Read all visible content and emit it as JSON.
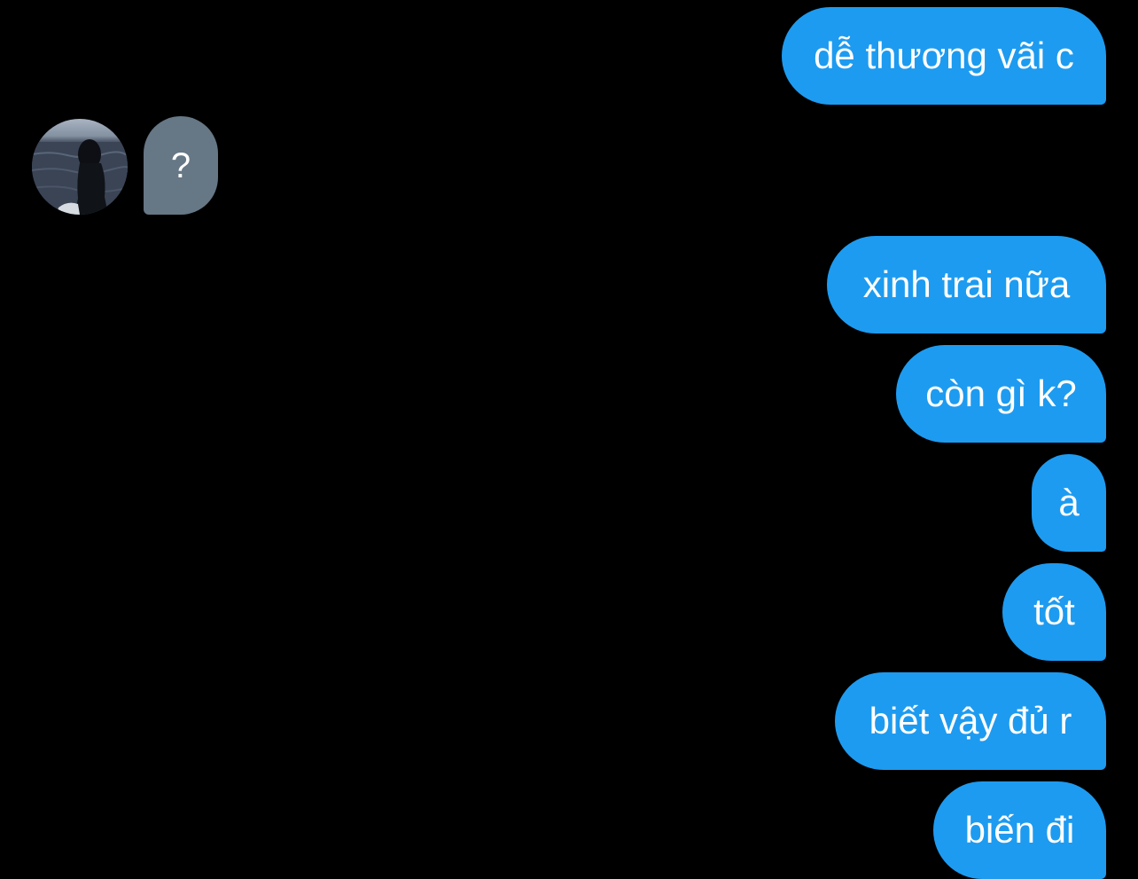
{
  "conversation": {
    "received": [
      {
        "text": "?"
      }
    ],
    "sent": [
      {
        "text": "dễ thương vãi c"
      },
      {
        "text": "xinh trai nữa"
      },
      {
        "text": "còn gì k?"
      },
      {
        "text": "à"
      },
      {
        "text": "tốt"
      },
      {
        "text": "biết vậy đủ r"
      },
      {
        "text": "biến đi"
      }
    ]
  },
  "colors": {
    "background": "#000000",
    "sent_bubble": "#1d9bf0",
    "received_bubble": "#667786",
    "text": "#ffffff"
  },
  "icons": {
    "avatar": "profile-photo"
  }
}
